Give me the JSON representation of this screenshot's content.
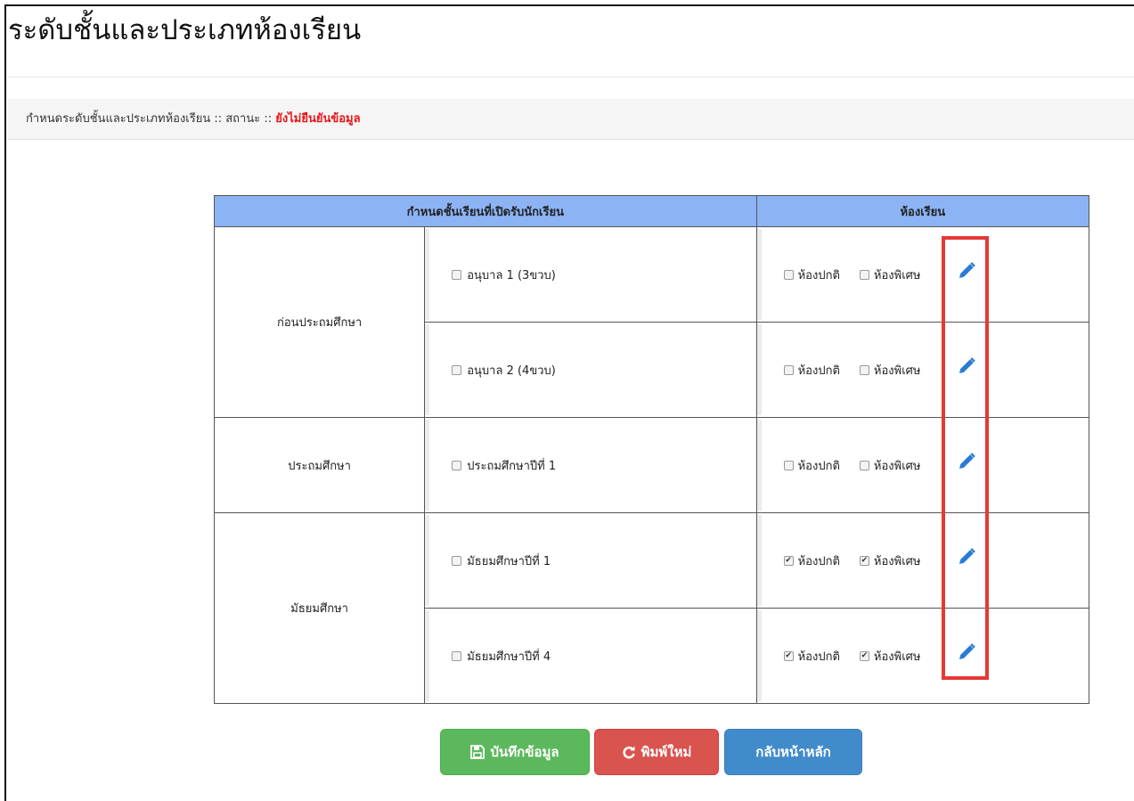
{
  "page": {
    "title": "ระดับชั้นและประเภทห้องเรียน",
    "status_label": "กำหนดระดับชั้นและประเภทห้องเรียน :: สถานะ :: ",
    "status_value": "ยังไม่ยืนยันข้อมูล"
  },
  "table": {
    "headers": [
      "กำหนดชั้นเรียนที่เปิดรับนักเรียน",
      "ห้องเรียน"
    ],
    "room_options": [
      "ห้องปกติ",
      "ห้องพิเศษ"
    ],
    "groups": [
      {
        "level": "ก่อนประถมศึกษา",
        "rows": [
          {
            "class": "อนุบาล 1 (3ขวบ)",
            "class_checked": false,
            "normal_checked": false,
            "special_checked": false
          },
          {
            "class": "อนุบาล 2 (4ขวบ)",
            "class_checked": false,
            "normal_checked": false,
            "special_checked": false
          }
        ]
      },
      {
        "level": "ประถมศึกษา",
        "rows": [
          {
            "class": "ประถมศึกษาปีที่ 1",
            "class_checked": false,
            "normal_checked": false,
            "special_checked": false
          }
        ]
      },
      {
        "level": "มัธยมศึกษา",
        "rows": [
          {
            "class": "มัธยมศึกษาปีที่ 1",
            "class_checked": false,
            "normal_checked": true,
            "special_checked": true
          },
          {
            "class": "มัธยมศึกษาปีที่ 4",
            "class_checked": false,
            "normal_checked": true,
            "special_checked": true
          }
        ]
      }
    ]
  },
  "buttons": {
    "save": "บันทึกข้อมูล",
    "reset": "พิมพ์ใหม่",
    "home": "กลับหน้าหลัก"
  },
  "icons": {
    "edit": "pencil-icon",
    "save": "floppy-disk-icon",
    "reset": "refresh-icon"
  },
  "colors": {
    "header_bg": "#8cb4f5",
    "status_warning": "#e8161a",
    "highlight": "#e53935",
    "save_btn": "#5cb85c",
    "reset_btn": "#d9534f",
    "home_btn": "#428bca",
    "edit_icon": "#2a7bd6"
  }
}
